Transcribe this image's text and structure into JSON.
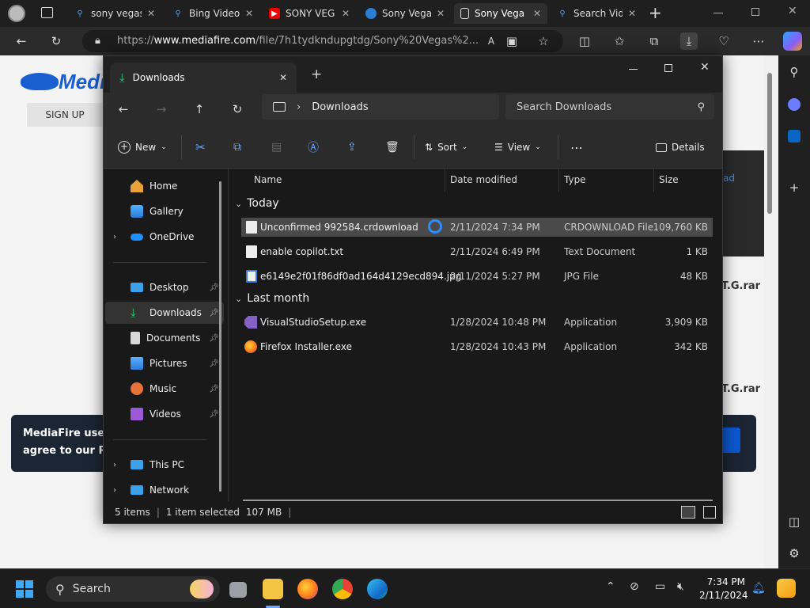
{
  "browser": {
    "tabs": [
      {
        "title": "sony vegas",
        "icon": "search-icon"
      },
      {
        "title": "Bing Video",
        "icon": "search-icon"
      },
      {
        "title": "SONY VEG",
        "icon": "youtube-icon"
      },
      {
        "title": "Sony Vega",
        "icon": "edge-icon"
      },
      {
        "title": "Sony Vega",
        "icon": "document-icon"
      },
      {
        "title": "Search Vid",
        "icon": "search-icon"
      }
    ],
    "new_tab": "+",
    "url_prefix": "https://",
    "url_domain": "www.mediafire.com",
    "url_path": "/file/7h1tydkndupgtdg/Sony%20Vegas%2..."
  },
  "page": {
    "logo": "Medi",
    "signup": "SIGN UP",
    "cookie_line1": "MediaFire uses c",
    "cookie_line2": "agree to our Priva",
    "peek1": "T.G.rar",
    "peek2": "T.G.rar",
    "peek_link": "ad"
  },
  "explorer": {
    "tab_title": "Downloads",
    "breadcrumb": "Downloads",
    "search_placeholder": "Search Downloads",
    "cmd": {
      "new": "New",
      "sort": "Sort",
      "view": "View",
      "details": "Details"
    },
    "nav": [
      {
        "label": "Home",
        "icon": "home-icon"
      },
      {
        "label": "Gallery",
        "icon": "gallery-icon"
      },
      {
        "label": "OneDrive",
        "icon": "onedrive-icon"
      },
      {
        "label": "Desktop",
        "icon": "desktop-icon"
      },
      {
        "label": "Downloads",
        "icon": "download-icon"
      },
      {
        "label": "Documents",
        "icon": "documents-icon"
      },
      {
        "label": "Pictures",
        "icon": "pictures-icon"
      },
      {
        "label": "Music",
        "icon": "music-icon"
      },
      {
        "label": "Videos",
        "icon": "videos-icon"
      },
      {
        "label": "This PC",
        "icon": "pc-icon"
      },
      {
        "label": "Network",
        "icon": "network-icon"
      }
    ],
    "columns": {
      "name": "Name",
      "date": "Date modified",
      "type": "Type",
      "size": "Size"
    },
    "groups": {
      "today": "Today",
      "last_month": "Last month"
    },
    "files": [
      {
        "name": "Unconfirmed 992584.crdownload",
        "date": "2/11/2024 7:34 PM",
        "type": "CRDOWNLOAD File",
        "size": "109,760 KB"
      },
      {
        "name": "enable copilot.txt",
        "date": "2/11/2024 6:49 PM",
        "type": "Text Document",
        "size": "1 KB"
      },
      {
        "name": "e6149e2f01f86df0ad164d4129ecd894.jpg",
        "date": "2/11/2024 5:27 PM",
        "type": "JPG File",
        "size": "48 KB"
      },
      {
        "name": "VisualStudioSetup.exe",
        "date": "1/28/2024 10:48 PM",
        "type": "Application",
        "size": "3,909 KB"
      },
      {
        "name": "Firefox Installer.exe",
        "date": "1/28/2024 10:43 PM",
        "type": "Application",
        "size": "342 KB"
      }
    ],
    "status": {
      "items": "5 items",
      "selected": "1 item selected",
      "size": "107 MB"
    }
  },
  "taskbar": {
    "search": "Search",
    "time": "7:34 PM",
    "date": "2/11/2024"
  },
  "colors": {
    "accent": "#0b57d0",
    "mediafire_blue": "#1a5fd1",
    "selected_row": "#4a4a4a"
  }
}
